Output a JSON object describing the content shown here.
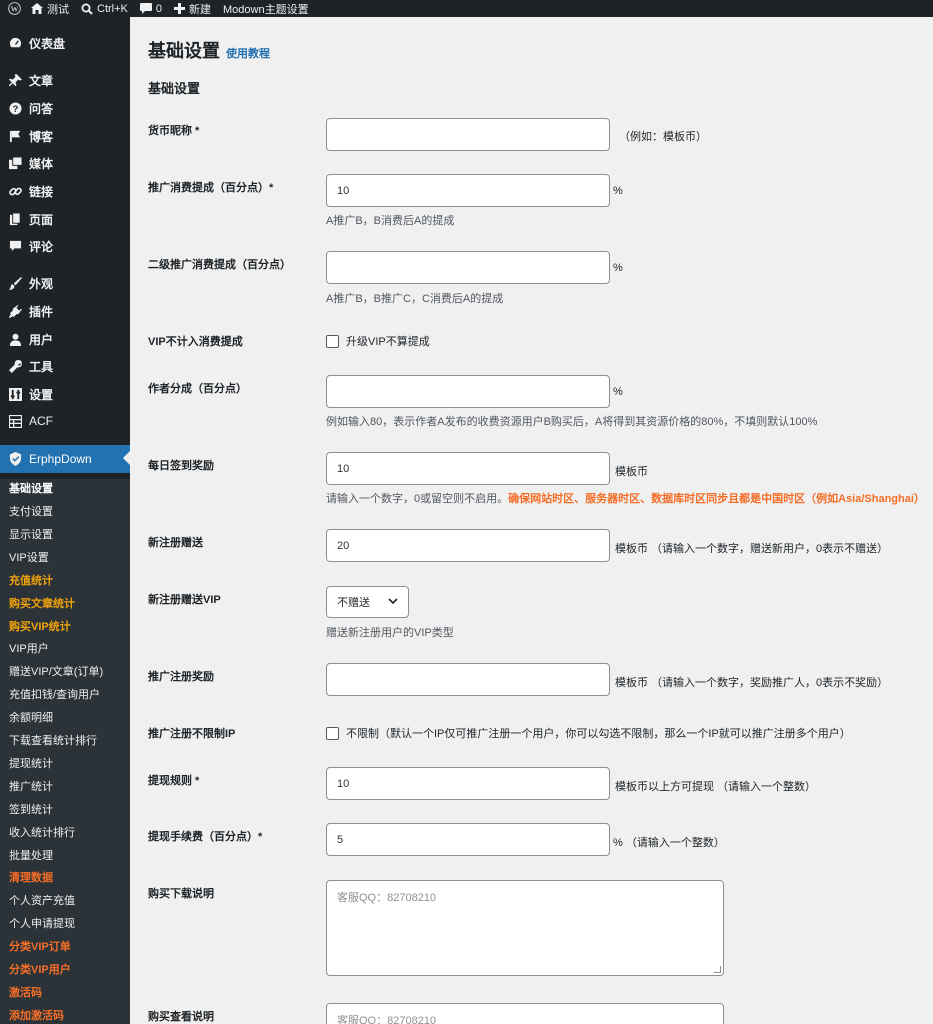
{
  "adminbar": {
    "site_name": "测试",
    "search_shortcut": "Ctrl+K",
    "comments_count": "0",
    "new_label": "新建",
    "theme_settings": "Modown主题设置",
    "icons": [
      "wordpress-icon",
      "home-icon",
      "search-icon",
      "comment-icon",
      "plus-icon"
    ]
  },
  "sidebar": {
    "menu": [
      {
        "label": "仪表盘",
        "icon": "dashboard-icon"
      },
      {
        "label": "文章",
        "icon": "pin-icon"
      },
      {
        "label": "问答",
        "icon": "question-icon"
      },
      {
        "label": "博客",
        "icon": "flag-icon"
      },
      {
        "label": "媒体",
        "icon": "media-icon"
      },
      {
        "label": "链接",
        "icon": "link-icon"
      },
      {
        "label": "页面",
        "icon": "page-icon"
      },
      {
        "label": "评论",
        "icon": "comment-icon"
      },
      {
        "label": "外观",
        "icon": "brush-icon"
      },
      {
        "label": "插件",
        "icon": "plugin-icon"
      },
      {
        "label": "用户",
        "icon": "user-icon"
      },
      {
        "label": "工具",
        "icon": "wrench-icon"
      },
      {
        "label": "设置",
        "icon": "settings-icon"
      },
      {
        "label": "ACF",
        "icon": "grid-icon"
      },
      {
        "label": "ErphpDown",
        "icon": "shield-icon"
      }
    ],
    "submenu": [
      {
        "label": "基础设置",
        "style": "active"
      },
      {
        "label": "支付设置",
        "style": "normal"
      },
      {
        "label": "显示设置",
        "style": "normal"
      },
      {
        "label": "VIP设置",
        "style": "normal"
      },
      {
        "label": "充值统计",
        "style": "orange"
      },
      {
        "label": "购买文章统计",
        "style": "orange"
      },
      {
        "label": "购买VIP统计",
        "style": "orange"
      },
      {
        "label": "VIP用户",
        "style": "normal"
      },
      {
        "label": "赠送VIP/文章(订单)",
        "style": "normal"
      },
      {
        "label": "充值扣钱/查询用户",
        "style": "normal"
      },
      {
        "label": "余额明细",
        "style": "normal"
      },
      {
        "label": "下载查看统计排行",
        "style": "normal"
      },
      {
        "label": "提现统计",
        "style": "normal"
      },
      {
        "label": "推广统计",
        "style": "normal"
      },
      {
        "label": "签到统计",
        "style": "normal"
      },
      {
        "label": "收入统计排行",
        "style": "normal"
      },
      {
        "label": "批量处理",
        "style": "normal"
      },
      {
        "label": "清理数据",
        "style": "red"
      },
      {
        "label": "个人资产充值",
        "style": "normal"
      },
      {
        "label": "个人申请提现",
        "style": "normal"
      },
      {
        "label": "分类VIP订单",
        "style": "red"
      },
      {
        "label": "分类VIP用户",
        "style": "red"
      },
      {
        "label": "激活码",
        "style": "red"
      },
      {
        "label": "添加激活码",
        "style": "red"
      }
    ]
  },
  "main": {
    "title": "基础设置",
    "tutorial_link": "使用教程",
    "section_title": "基础设置",
    "fields": {
      "currency_name": {
        "label": "货币昵称 *",
        "value": "",
        "suffix": "（例如：模板币）"
      },
      "promo_commission": {
        "label": "推广消费提成（百分点）*",
        "value": "10",
        "suffix": "%",
        "desc": "A推广B，B消费后A的提成"
      },
      "promo_commission_2": {
        "label": "二级推广消费提成（百分点）",
        "value": "",
        "suffix": "%",
        "desc": "A推广B，B推广C，C消费后A的提成"
      },
      "vip_exclude": {
        "label": "VIP不计入消费提成",
        "checkbox_label": "升级VIP不算提成"
      },
      "author_share": {
        "label": "作者分成（百分点）",
        "value": "",
        "suffix": "%",
        "desc": "例如输入80，表示作者A发布的收费资源用户B购买后，A将得到其资源价格的80%，不填则默认100%"
      },
      "daily_checkin": {
        "label": "每日签到奖励",
        "value": "10",
        "suffix": "模板币",
        "desc": "请输入一个数字，0或留空则不启用。",
        "desc_warn": "确保网站时区、服务器时区、数据库时区同步且都是中国时区（例如Asia/Shanghai）"
      },
      "register_gift": {
        "label": "新注册赠送",
        "value": "20",
        "suffix": "模板币  （请输入一个数字，赠送新用户，0表示不赠送）"
      },
      "register_vip": {
        "label": "新注册赠送VIP",
        "selected": "不赠送",
        "desc": "赠送新注册用户的VIP类型"
      },
      "promo_register_reward": {
        "label": "推广注册奖励",
        "value": "",
        "suffix": "模板币  （请输入一个数字，奖励推广人，0表示不奖励）"
      },
      "promo_ip_unlimited": {
        "label": "推广注册不限制IP",
        "checkbox_label": "不限制（默认一个IP仅可推广注册一个用户，你可以勾选不限制，那么一个IP就可以推广注册多个用户）"
      },
      "withdraw_rule": {
        "label": "提现规则 *",
        "value": "10",
        "suffix": "模板币以上方可提现  （请输入一个整数）"
      },
      "withdraw_fee": {
        "label": "提现手续费（百分点）*",
        "value": "5",
        "suffix": "%  （请输入一个整数）"
      },
      "buy_download_desc": {
        "label": "购买下载说明",
        "placeholder": "客服QQ：82708210"
      },
      "buy_view_desc": {
        "label": "购买查看说明",
        "placeholder": "客服QQ：82708210"
      }
    }
  }
}
